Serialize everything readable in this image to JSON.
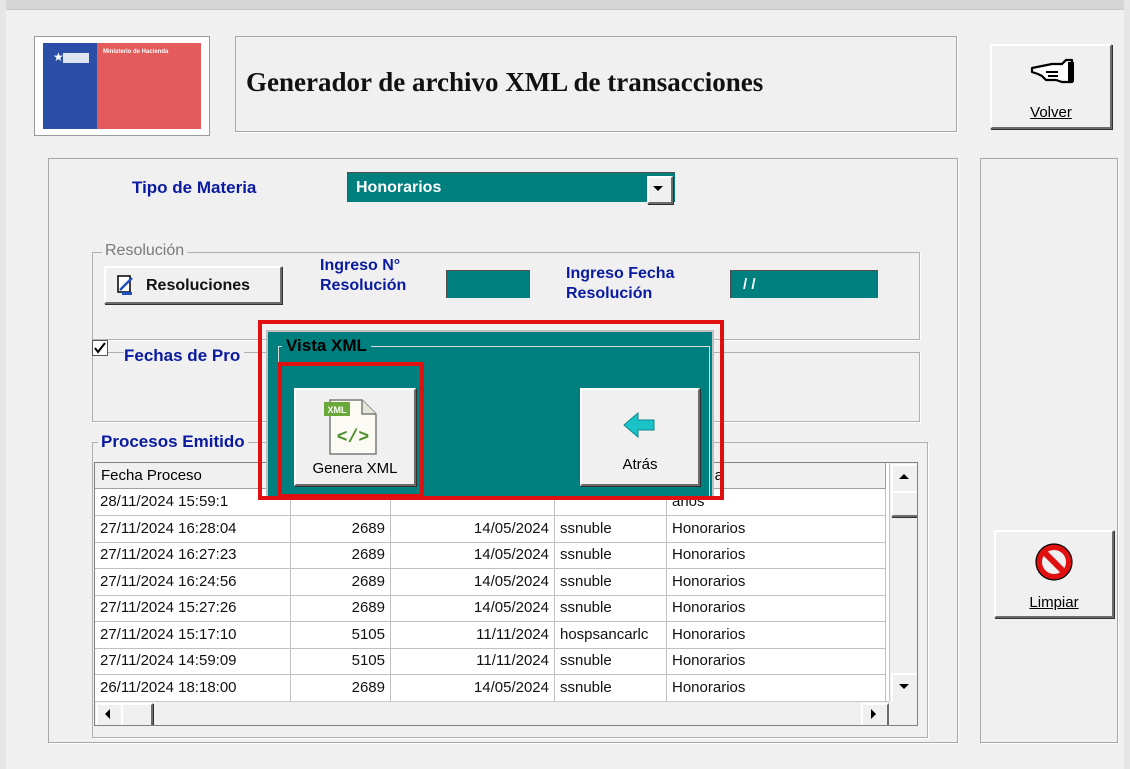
{
  "header": {
    "logo_text": "Ministerio de Hacienda",
    "title": "Generador de archivo XML de transacciones",
    "back_button_label": "Volver"
  },
  "form": {
    "tipo_materia_label": "Tipo de Materia",
    "tipo_materia_value": "Honorarios",
    "resolucion_group_label": "Resolución",
    "resoluciones_button_label": "Resoluciones",
    "ingreso_numero_label_line1": "Ingreso N°",
    "ingreso_numero_label_line2": "Resolución",
    "ingreso_numero_value": "",
    "ingreso_fecha_label_line1": "Ingreso Fecha",
    "ingreso_fecha_label_line2": "Resolución",
    "ingreso_fecha_value": "/ /",
    "fechas_checkbox_label": "Fechas de Pro"
  },
  "procesos": {
    "group_label": "Procesos Emitido",
    "columns": [
      "Fecha Proceso",
      "",
      "",
      "",
      "Materia"
    ],
    "rows": [
      [
        "28/11/2024 15:59:1",
        "",
        "",
        "",
        "arios"
      ],
      [
        "27/11/2024 16:28:04",
        "2689",
        "14/05/2024",
        "ssnuble",
        "Honorarios"
      ],
      [
        "27/11/2024 16:27:23",
        "2689",
        "14/05/2024",
        "ssnuble",
        "Honorarios"
      ],
      [
        "27/11/2024 16:24:56",
        "2689",
        "14/05/2024",
        "ssnuble",
        "Honorarios"
      ],
      [
        "27/11/2024 15:27:26",
        "2689",
        "14/05/2024",
        "ssnuble",
        "Honorarios"
      ],
      [
        "27/11/2024 15:17:10",
        "5105",
        "11/11/2024",
        "hospsancarlc",
        "Honorarios"
      ],
      [
        "27/11/2024 14:59:09",
        "5105",
        "11/11/2024",
        "ssnuble",
        "Honorarios"
      ],
      [
        "26/11/2024 18:18:00",
        "2689",
        "14/05/2024",
        "ssnuble",
        "Honorarios"
      ]
    ]
  },
  "side": {
    "clear_button_label": "Limpiar"
  },
  "dialog": {
    "title": "Vista XML",
    "genera_button_label": "Genera XML",
    "atras_button_label": "Atrás",
    "xml_badge": "XML",
    "xml_glyph": "</>"
  },
  "colors": {
    "teal": "#007f7f",
    "highlight_red": "#e01010",
    "label_blue": "#0a1aa0"
  },
  "icons": {
    "volver": "pointing-hand-icon",
    "limpiar": "prohibited-icon",
    "resoluciones": "document-icon",
    "genera": "xml-file-icon",
    "atras": "arrow-left-icon",
    "combo": "chevron-down-icon"
  }
}
